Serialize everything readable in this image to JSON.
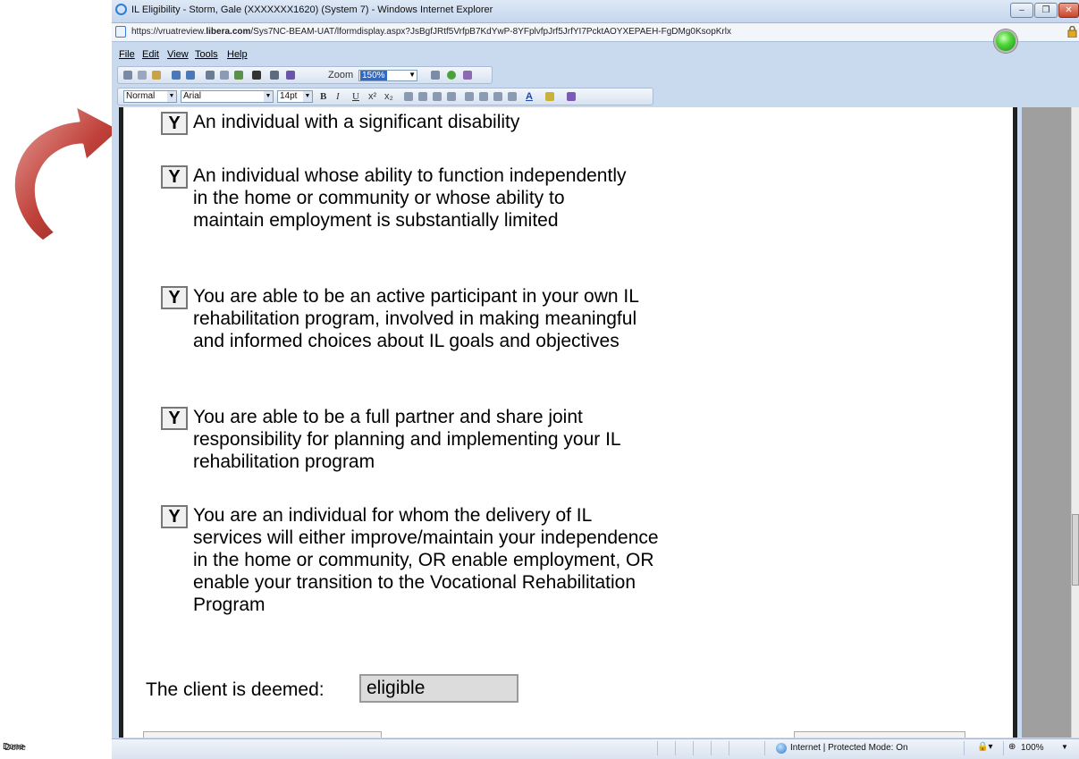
{
  "window": {
    "title": "IL Eligibility - Storm, Gale (XXXXXXX1620) (System 7) - Windows Internet Explorer",
    "controls": {
      "minimize": "–",
      "maximize": "❐",
      "close": "✕"
    }
  },
  "address": {
    "prefix": "https://vruatreview.",
    "domain": "libera.com",
    "path": "/Sys7NC-BEAM-UAT/lformdisplay.aspx?JsBgfJRtf5VrfpB7KdYwP-8YFplvfpJrf5JrfYI7PcktAOYXEPAEH-FgDMg0KsopKrlx"
  },
  "menu": {
    "file": "File",
    "edit": "Edit",
    "view": "View",
    "tools": "Tools",
    "help": "Help"
  },
  "toolbar": {
    "zoom_label": "Zoom",
    "zoom_value": "150%"
  },
  "format_bar": {
    "style": "Normal",
    "font": "Arial",
    "size": "14pt",
    "bold": "B",
    "italic": "I",
    "underline": "U",
    "superscript": "x²",
    "subscript": "x₂",
    "font_color": "A"
  },
  "criteria": [
    {
      "mark": "Y",
      "text": "An individual with a significant disability"
    },
    {
      "mark": "Y",
      "text": "An individual whose ability to function independently in the home or community or whose ability to maintain employment is substantially limited"
    },
    {
      "mark": "Y",
      "text": "You are able to be an active participant in your own IL rehabilitation program, involved in making meaningful and informed choices about IL goals and objectives"
    },
    {
      "mark": "Y",
      "text": "You are able to be a full partner and share joint responsibility for planning and implementing your IL rehabilitation program"
    },
    {
      "mark": "Y",
      "text": "You are an individual for whom the delivery of IL services will either improve/maintain your independence in the home or community, OR enable employment, OR enable your transition to the Vocational Rehabilitation Program"
    }
  ],
  "deemed": {
    "label": "The client is deemed:",
    "value": "eligible"
  },
  "status": {
    "left": "Done",
    "zone": "Internet | Protected Mode: On",
    "zoom": "100%"
  },
  "colors": {
    "arrow": "#b8403a",
    "status_orb": "#3ec22a",
    "titlebar": "#c4d6ee"
  }
}
